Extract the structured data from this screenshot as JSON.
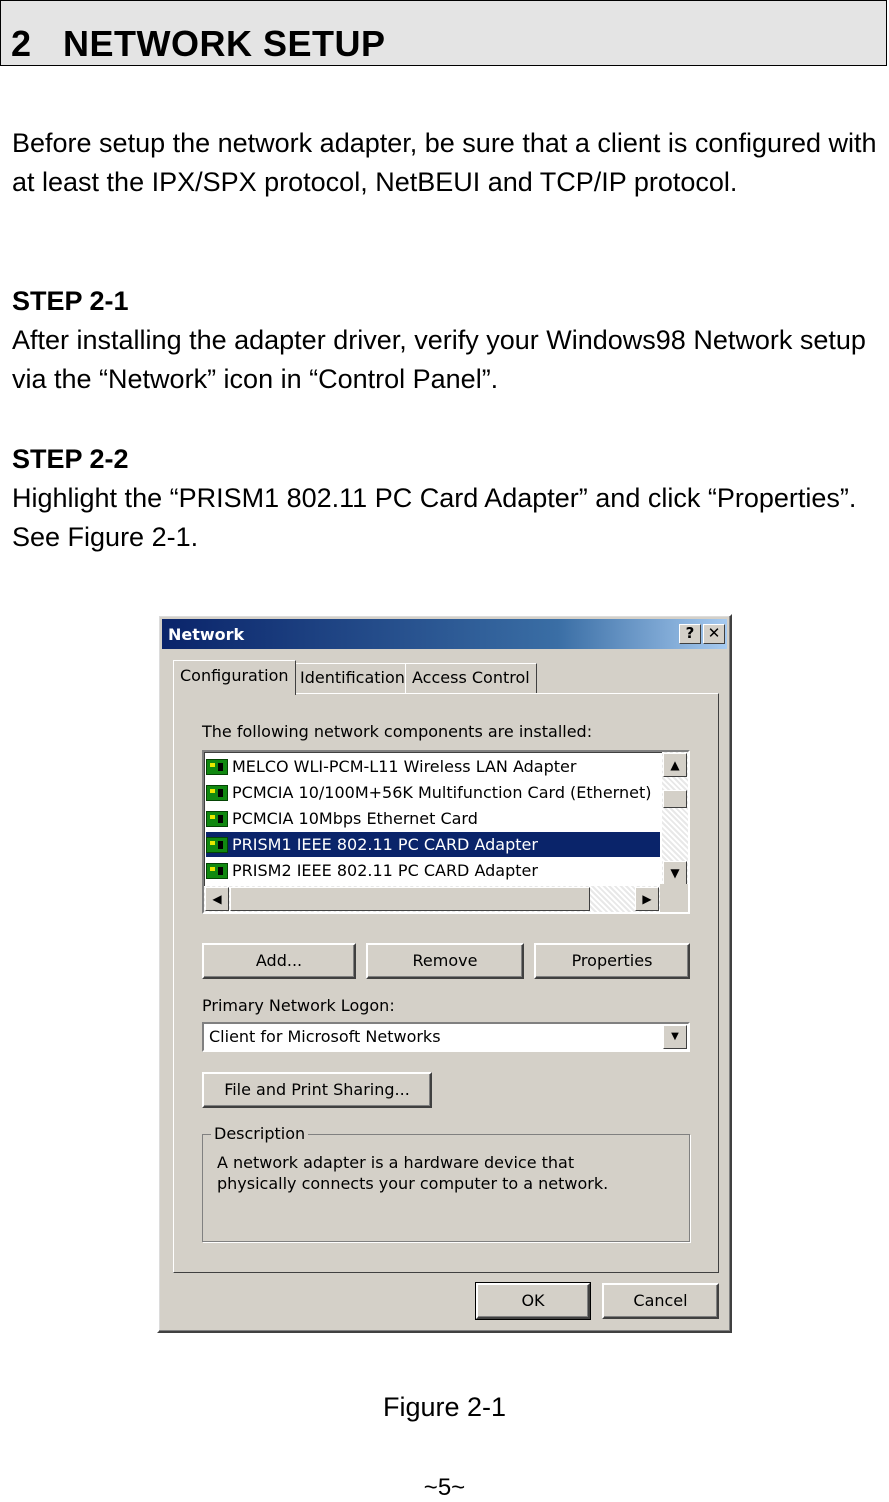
{
  "section": {
    "title": "2   NETWORK SETUP"
  },
  "intro": "Before setup the network adapter, be sure that a client is configured with at least the IPX/SPX protocol, NetBEUI and TCP/IP protocol.",
  "steps": [
    {
      "title": "STEP 2-1",
      "text": "After installing the adapter driver, verify your Windows98 Network setup via the “Network” icon in “Control Panel”."
    },
    {
      "title": "STEP 2-2",
      "text": "Highlight the “PRISM1 802.11 PC Card Adapter” and click “Properties”. See Figure 2-1."
    }
  ],
  "dialog": {
    "title": "Network",
    "title_buttons": [
      "?",
      "✕"
    ],
    "tabs": [
      "Configuration",
      "Identification",
      "Access Control"
    ],
    "active_tab": "Configuration",
    "components_label": "The following network components are installed:",
    "components": [
      "MELCO WLI-PCM-L11 Wireless LAN Adapter",
      "PCMCIA 10/100M+56K Multifunction Card (Ethernet)",
      "PCMCIA 10Mbps Ethernet Card",
      "PRISM1 IEEE 802.11 PC CARD Adapter",
      "PRISM2 IEEE 802.11 PC CARD Adapter"
    ],
    "selected_component": "PRISM1 IEEE 802.11 PC CARD Adapter",
    "scroll_arrows": {
      "up": "▲",
      "down": "▼",
      "left": "◀",
      "right": "▶"
    },
    "buttons": {
      "add": "Add...",
      "remove": "Remove",
      "properties": "Properties"
    },
    "logon_label": "Primary Network Logon:",
    "logon_value": "Client for Microsoft Networks",
    "file_print_button": "File and Print Sharing...",
    "description_title": "Description",
    "description_text": "A network adapter is a hardware device that physically connects your computer to a network.",
    "ok_button": "OK",
    "cancel_button": "Cancel",
    "colors": {
      "titlebar": "#0a246a",
      "selection": "#0a246a",
      "face": "#d4d0c8"
    }
  },
  "figure_caption": "Figure 2-1",
  "page_number": "~5~"
}
